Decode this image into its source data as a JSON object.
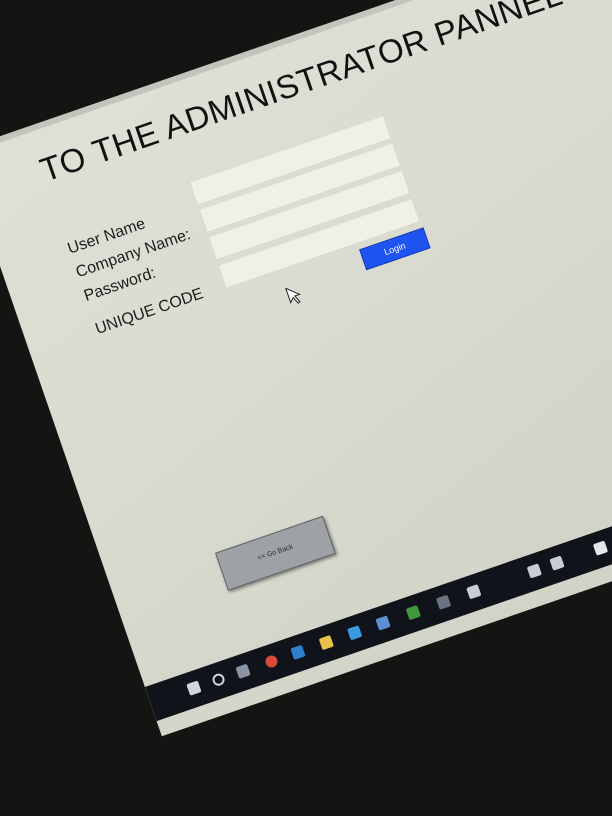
{
  "page": {
    "title": "TO THE ADMINISTRATOR PANNEL"
  },
  "form": {
    "user_name_label": "User Name",
    "company_name_label": "Company Name:",
    "password_label": "Password:",
    "unique_code_label": "UNIQUE CODE",
    "user_name_value": "",
    "company_name_value": "",
    "password_value": "",
    "unique_code_value": ""
  },
  "buttons": {
    "login_label": "Login",
    "go_back_label": "<< Go Back"
  },
  "colors": {
    "login_button": "#1f54f2",
    "go_back_button": "#9ea2a6",
    "background": "#dcded3",
    "taskbar": "#101319"
  },
  "taskbar": {
    "icons": [
      "start-icon",
      "search-icon",
      "task-view-icon",
      "chrome-icon",
      "edge-icon",
      "file-explorer-icon",
      "store-icon",
      "mail-icon",
      "photos-icon",
      "app-icon",
      "notepad-icon",
      "network-icon",
      "volume-icon",
      "notification-icon"
    ]
  }
}
